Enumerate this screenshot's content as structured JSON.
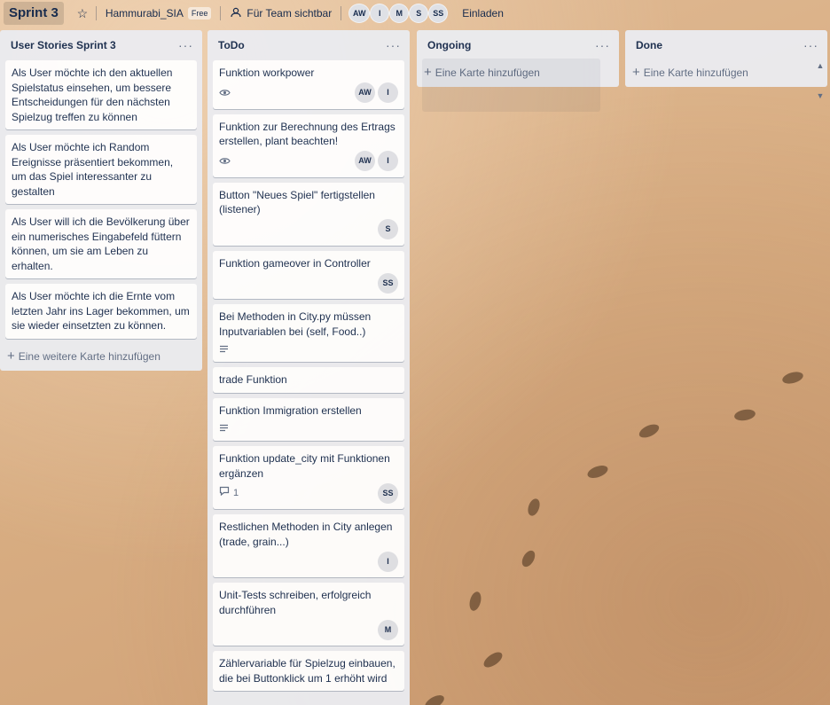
{
  "header": {
    "board_title": "Sprint 3",
    "team_name": "Hammurabi_SIA",
    "plan_badge": "Free",
    "visibility_label": "Für Team sichtbar",
    "members": [
      "AW",
      "I",
      "M",
      "S",
      "SS"
    ],
    "invite_label": "Einladen"
  },
  "lists": [
    {
      "title": "User Stories Sprint 3",
      "add_label": "Eine weitere Karte hinzufügen",
      "cards": [
        {
          "text": "Als User möchte ich den aktuellen Spielstatus einsehen, um bessere Entscheidungen für den nächsten Spielzug treffen zu können"
        },
        {
          "text": "Als User möchte ich Random Ereignisse präsentiert bekommen, um das Spiel interessanter zu gestalten"
        },
        {
          "text": "Als User will ich die Bevölkerung über ein numerisches Eingabefeld füttern können, um sie am Leben zu erhalten."
        },
        {
          "text": "Als User möchte ich die Ernte vom letzten Jahr ins Lager bekommen, um sie wieder einsetzten zu können."
        }
      ]
    },
    {
      "title": "ToDo",
      "cards": [
        {
          "text": "Funktion workpower",
          "badge": "eye-icon",
          "members": [
            "AW",
            "I"
          ]
        },
        {
          "text": "Funktion zur Berechnung des Ertrags erstellen, plant beachten!",
          "badge": "eye-icon",
          "members": [
            "AW",
            "I"
          ]
        },
        {
          "text": "Button \"Neues Spiel\" fertigstellen (listener)",
          "members": [
            "S"
          ]
        },
        {
          "text": "Funktion gameover in Controller",
          "members": [
            "SS"
          ]
        },
        {
          "text": "Bei Methoden in City.py müssen Inputvariablen bei (self, Food..)",
          "badge": "description-icon"
        },
        {
          "text": "trade Funktion"
        },
        {
          "text": "Funktion Immigration erstellen",
          "badge": "description-icon"
        },
        {
          "text": "Funktion update_city mit Funktionen ergänzen",
          "badge": "comment-icon",
          "badge_count": "1",
          "members": [
            "SS"
          ]
        },
        {
          "text": "Restlichen Methoden in City anlegen (trade, grain...)",
          "members": [
            "I"
          ]
        },
        {
          "text": "Unit-Tests schreiben, erfolgreich durchführen",
          "members": [
            "M"
          ]
        },
        {
          "text": "Zählervariable für Spielzug einbauen, die bei Buttonklick um 1 erhöht wird"
        }
      ]
    },
    {
      "title": "Ongoing",
      "add_label": "Eine Karte hinzufügen"
    },
    {
      "title": "Done",
      "add_label": "Eine Karte hinzufügen"
    }
  ],
  "colors": {
    "list_bg": "#ebecf0",
    "card_bg": "#ffffff",
    "text": "#172b4d",
    "muted": "#5e6c84"
  }
}
